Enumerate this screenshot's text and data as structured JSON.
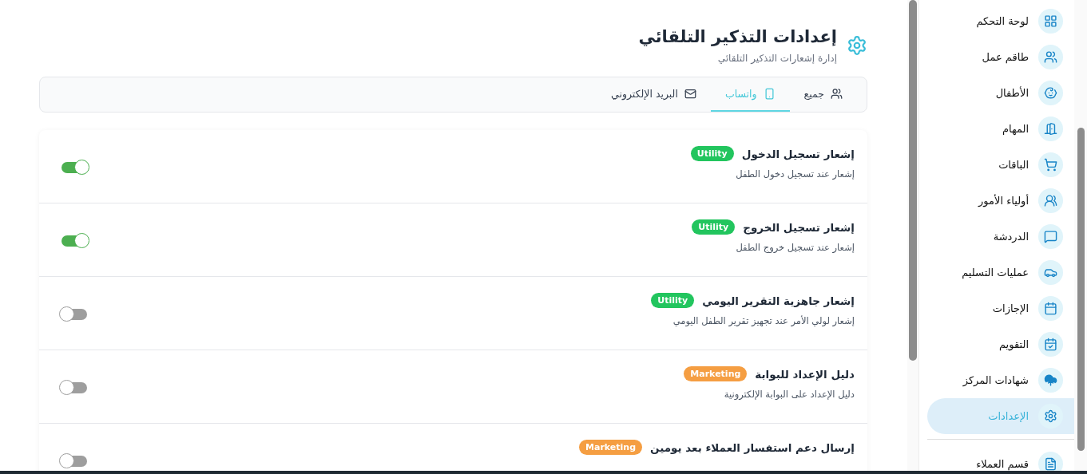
{
  "header": {
    "title": "إعدادات التذكير التلقائي",
    "subtitle": "إدارة إشعارات التذكير التلقائي"
  },
  "tabs": [
    {
      "label": "جميع",
      "selected": false
    },
    {
      "label": "واتساب",
      "selected": true
    },
    {
      "label": "البريد الإلكتروني",
      "selected": false
    }
  ],
  "notifications": [
    {
      "title": "إشعار تسجيل الدخول",
      "badge": "Utility",
      "kind": "utility",
      "description": "إشعار عند تسجيل دخول الطفل",
      "on": true
    },
    {
      "title": "إشعار تسجيل الخروج",
      "badge": "Utility",
      "kind": "utility",
      "description": "إشعار عند تسجيل خروج الطفل",
      "on": true
    },
    {
      "title": "إشعار جاهزية التقرير اليومي",
      "badge": "Utility",
      "kind": "utility",
      "description": "إشعار لولي الأمر عند تجهيز تقرير الطفل اليومي",
      "on": false
    },
    {
      "title": "دليل الإعداد للبوابة",
      "badge": "Marketing",
      "kind": "marketing",
      "description": "دليل الإعداد على البوابة الإلكترونية",
      "on": false
    },
    {
      "title": "إرسال دعم استفسار العملاء بعد يومين",
      "badge": "Marketing",
      "kind": "marketing",
      "on": false
    }
  ],
  "sidebar": {
    "items": [
      {
        "label": "لوحة التحكم",
        "selected": false
      },
      {
        "label": "طاقم عمل",
        "selected": false
      },
      {
        "label": "الأطفال",
        "selected": false
      },
      {
        "label": "المهام",
        "selected": false
      },
      {
        "label": "الباقات",
        "selected": false
      },
      {
        "label": "أولياء الأمور",
        "selected": false
      },
      {
        "label": "الدردشة",
        "selected": false
      },
      {
        "label": "عمليات التسليم",
        "selected": false
      },
      {
        "label": "الإجازات",
        "selected": false
      },
      {
        "label": "التقويم",
        "selected": false
      },
      {
        "label": "شهادات المركز",
        "selected": false
      },
      {
        "label": "الإعدادات",
        "selected": true
      },
      {
        "label": "قسم العملاء",
        "selected": false
      }
    ]
  }
}
